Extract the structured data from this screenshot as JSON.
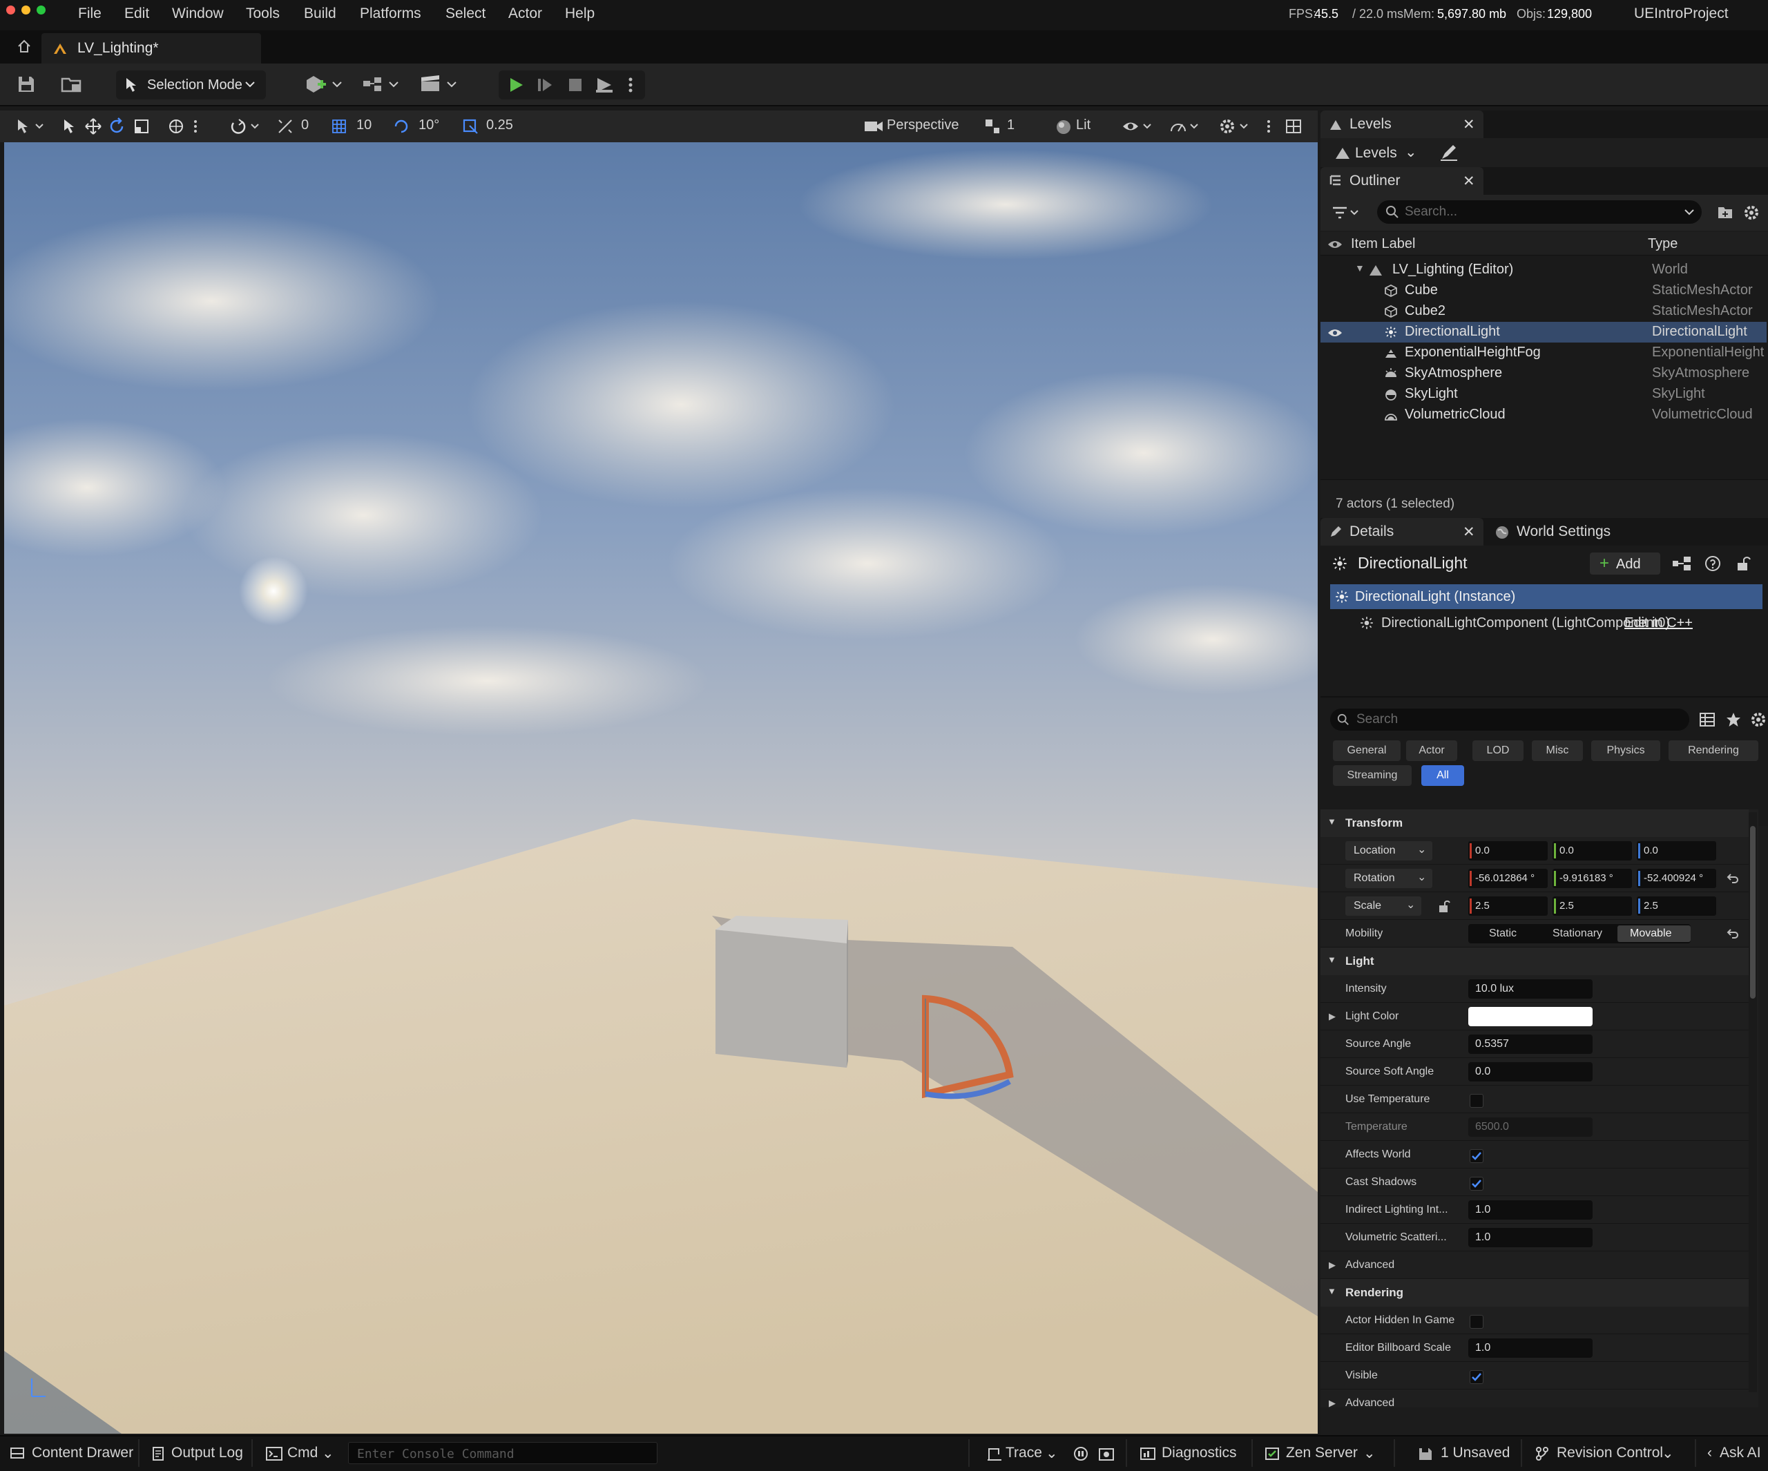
{
  "menubar": {
    "items": [
      "File",
      "Edit",
      "Window",
      "Tools",
      "Build",
      "Platforms",
      "Select",
      "Actor",
      "Help"
    ],
    "stats": {
      "fps_label": "FPS:",
      "fps_value": "45.5",
      "ms": "/ 22.0 ms",
      "mem_label": "Mem:",
      "mem_value": "5,697.80 mb",
      "objs_label": "Objs:",
      "objs_value": "129,800"
    },
    "project": "UEIntroProject"
  },
  "tab": {
    "title": "LV_Lighting*"
  },
  "toolbar": {
    "selection_mode": "Selection Mode"
  },
  "viewport_toolbar": {
    "translate_snap": "0",
    "grid_snap": "10",
    "rotate_snap": "10°",
    "scale_snap": "0.25",
    "view": "Perspective",
    "camera_speed": "1",
    "view_mode": "Lit"
  },
  "levels": {
    "panel_title": "Levels",
    "dropdown": "Levels"
  },
  "outliner": {
    "panel_title": "Outliner",
    "search_placeholder": "Search...",
    "col_label": "Item Label",
    "col_type": "Type",
    "rows": [
      {
        "label": "LV_Lighting (Editor)",
        "type": "World"
      },
      {
        "label": "Cube",
        "type": "StaticMeshActor"
      },
      {
        "label": "Cube2",
        "type": "StaticMeshActor"
      },
      {
        "label": "DirectionalLight",
        "type": "DirectionalLight"
      },
      {
        "label": "ExponentialHeightFog",
        "type": "ExponentialHeight"
      },
      {
        "label": "SkyAtmosphere",
        "type": "SkyAtmosphere"
      },
      {
        "label": "SkyLight",
        "type": "SkyLight"
      },
      {
        "label": "VolumetricCloud",
        "type": "VolumetricCloud"
      }
    ],
    "summary": "7 actors (1 selected)"
  },
  "details": {
    "tab": "Details",
    "world_settings": "World Settings",
    "actor_name": "DirectionalLight",
    "add_label": "Add",
    "instance": "DirectionalLight (Instance)",
    "component": "DirectionalLightComponent (LightComponent0)",
    "edit_cpp": "Edit in C++",
    "search_placeholder": "Search",
    "filters": [
      "General",
      "Actor",
      "LOD",
      "Misc",
      "Physics",
      "Rendering",
      "Streaming",
      "All"
    ],
    "transform": {
      "title": "Transform",
      "location_label": "Location",
      "location": [
        "0.0",
        "0.0",
        "0.0"
      ],
      "rotation_label": "Rotation",
      "rotation": [
        "-56.012864 °",
        "-9.916183 °",
        "-52.400924 °"
      ],
      "scale_label": "Scale",
      "scale": [
        "2.5",
        "2.5",
        "2.5"
      ],
      "mobility_label": "Mobility",
      "mobility": [
        "Static",
        "Stationary",
        "Movable"
      ]
    },
    "light": {
      "title": "Light",
      "intensity_label": "Intensity",
      "intensity": "10.0 lux",
      "light_color_label": "Light Color",
      "source_angle_label": "Source Angle",
      "source_angle": "0.5357",
      "source_soft_angle_label": "Source Soft Angle",
      "source_soft_angle": "0.0",
      "use_temperature_label": "Use Temperature",
      "temperature_label": "Temperature",
      "temperature": "6500.0",
      "affects_world_label": "Affects World",
      "cast_shadows_label": "Cast Shadows",
      "indirect_label": "Indirect Lighting Int...",
      "indirect": "1.0",
      "volumetric_label": "Volumetric Scatteri...",
      "volumetric": "1.0",
      "advanced": "Advanced"
    },
    "rendering": {
      "title": "Rendering",
      "hidden_label": "Actor Hidden In Game",
      "billboard_label": "Editor Billboard Scale",
      "billboard": "1.0",
      "visible_label": "Visible",
      "advanced": "Advanced"
    }
  },
  "statusbar": {
    "content_drawer": "Content Drawer",
    "output_log": "Output Log",
    "cmd": "Cmd",
    "console_placeholder": "Enter Console Command",
    "trace": "Trace",
    "diagnostics": "Diagnostics",
    "zen": "Zen Server",
    "unsaved": "1 Unsaved",
    "revision": "Revision Control",
    "ask_ai": "Ask AI"
  }
}
